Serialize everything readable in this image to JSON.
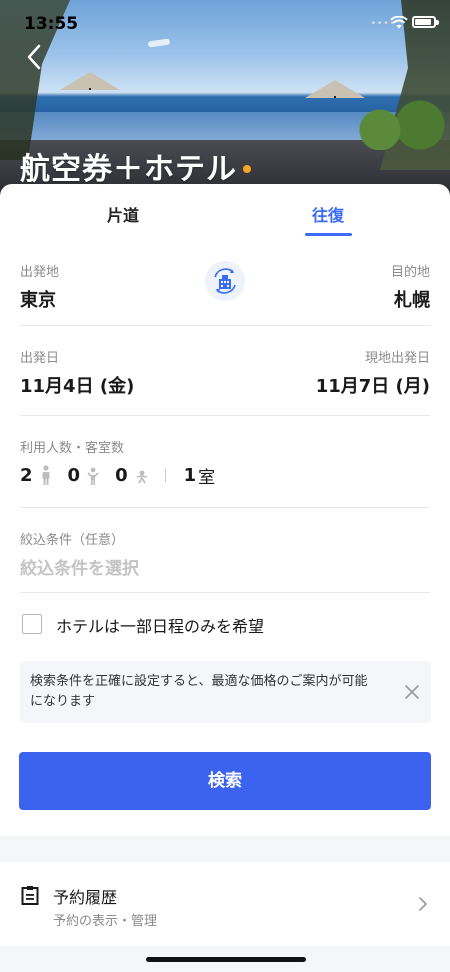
{
  "status_bar": {
    "time": "13:55",
    "signal_dots": "••••"
  },
  "header": {
    "title": "航空券＋ホテル",
    "dot_color": "#f5a623"
  },
  "tabs": [
    {
      "label": "片道",
      "active": false
    },
    {
      "label": "往復",
      "active": true
    }
  ],
  "route": {
    "origin_label": "出発地",
    "origin_value": "東京",
    "destination_label": "目的地",
    "destination_value": "札幌",
    "swap_icon": "swap-icon"
  },
  "dates": {
    "departure_label": "出発日",
    "departure_value": "11月4日 (金)",
    "return_label": "現地出発日",
    "return_value": "11月7日 (月)"
  },
  "guests": {
    "label": "利用人数・客室数",
    "adults": "2",
    "children": "0",
    "infants": "0",
    "rooms": "1",
    "room_unit": "室"
  },
  "filter": {
    "label": "絞込条件（任意）",
    "placeholder": "絞込条件を選択"
  },
  "partial_stay": {
    "label": "ホテルは一部日程のみを希望",
    "checked": false
  },
  "notice": {
    "text": "検索条件を正確に設定すると、最適な価格のご案内が可能になります"
  },
  "search_button": {
    "label": "検索",
    "color": "#3b63f0"
  },
  "booking_history": {
    "title": "予約履歴",
    "subtitle": "予約の表示・管理"
  },
  "colors": {
    "accent": "#3b6cf6"
  }
}
